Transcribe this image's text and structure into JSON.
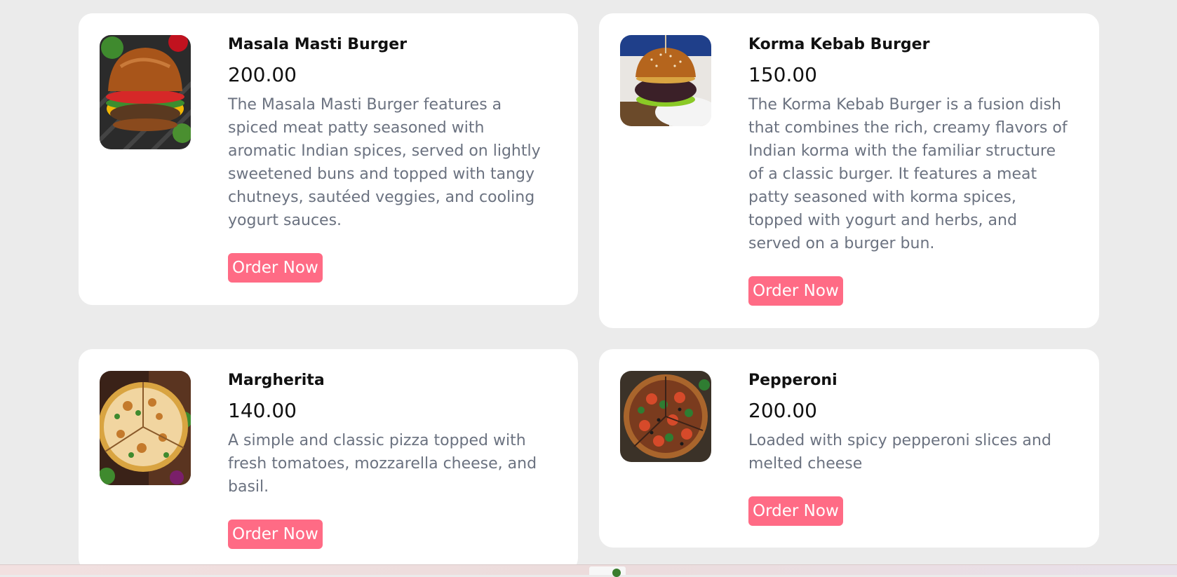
{
  "colors": {
    "background": "#ebebeb",
    "card": "#ffffff",
    "accent": "#ff6b85",
    "title": "#111111",
    "description": "#6b7280"
  },
  "menu": {
    "items": [
      {
        "title": "Masala Masti Burger",
        "price": "200.00",
        "description": "The Masala Masti Burger features a spiced meat patty seasoned with aromatic Indian spices, served on lightly sweetened buns and topped with tangy chutneys, sautéed veggies, and cooling yogurt sauces.",
        "button": "Order Now",
        "image": "burger-photo"
      },
      {
        "title": "Korma Kebab Burger",
        "price": "150.00",
        "description": "The Korma Kebab Burger is a fusion dish that combines the rich, creamy flavors of Indian korma with the familiar structure of a classic burger. It features a meat patty seasoned with korma spices, topped with yogurt and herbs, and served on a burger bun.",
        "button": "Order Now",
        "image": "burger-photo"
      },
      {
        "title": "Margherita",
        "price": "140.00",
        "description": "A simple and classic pizza topped with fresh tomatoes, mozzarella cheese, and basil.",
        "button": "Order Now",
        "image": "pizza-photo"
      },
      {
        "title": "Pepperoni",
        "price": "200.00",
        "description": "Loaded with spicy pepperoni slices and melted cheese",
        "button": "Order Now",
        "image": "pizza-photo"
      }
    ]
  }
}
